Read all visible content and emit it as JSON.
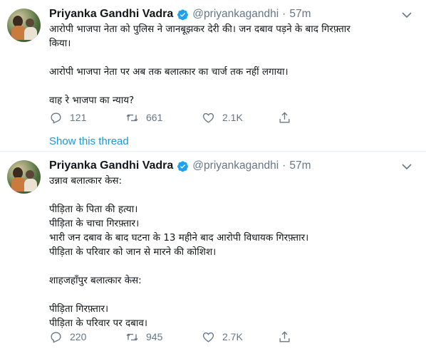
{
  "tweets": [
    {
      "author_name": "Priyanka Gandhi Vadra",
      "handle": "@priyankagandhi",
      "separator": "·",
      "time": "57m",
      "text": "आरोपी भाजपा नेता को पुलिस ने जानबूझकर देरी की। जन दबाव पड़ने के बाद गिरफ़्तार\nकिया।\n\nआरोपी भाजपा नेता पर अब तक बलात्कार का चार्ज तक नहीं लगाया।\n\nवाह रे भाजपा का न्याय?",
      "replies": "121",
      "retweets": "661",
      "likes": "2.1K",
      "show_thread": "Show this thread"
    },
    {
      "author_name": "Priyanka Gandhi Vadra",
      "handle": "@priyankagandhi",
      "separator": "·",
      "time": "57m",
      "text": "उन्नाव बलात्कार केस:\n\nपीड़िता के पिता की हत्या।\nपीड़िता के चाचा गिरफ़्तार।\nभारी जन दबाव के बाद घटना के 13 महीने बाद आरोपी विधायक गिरफ़्तार।\nपीड़िता के परिवार को जान से मारने की कोशिश।\n\nशाहजहाँपुर बलात्कार केस:\n\nपीड़िता गिरफ़्तार।\nपीड़िता के परिवार पर दबाव।",
      "replies": "220",
      "retweets": "945",
      "likes": "2.7K"
    }
  ],
  "colors": {
    "text": "#14171a",
    "secondary": "#657786",
    "link": "#1b95e0",
    "verified": "#1da1f2",
    "divider": "#e6ecf0"
  },
  "icons": [
    "verified-badge-icon",
    "chevron-down-icon",
    "reply-icon",
    "retweet-icon",
    "like-icon",
    "share-icon"
  ]
}
